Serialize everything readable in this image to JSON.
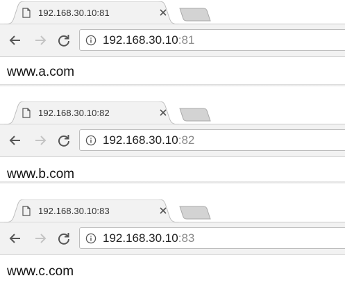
{
  "windows": [
    {
      "tab_title": "192.168.30.10:81",
      "url_host": "192.168.30.10",
      "url_port": ":81",
      "page_text": "www.a.com"
    },
    {
      "tab_title": "192.168.30.10:82",
      "url_host": "192.168.30.10",
      "url_port": ":82",
      "page_text": "www.b.com"
    },
    {
      "tab_title": "192.168.30.10:83",
      "url_host": "192.168.30.10",
      "url_port": ":83",
      "page_text": "www.c.com"
    }
  ],
  "icons": {
    "favicon": "page-icon",
    "close": "close-icon",
    "back": "back-arrow-icon",
    "forward": "forward-arrow-icon",
    "reload": "reload-icon",
    "site_info": "info-icon"
  },
  "colors": {
    "toolbar": "#f2f2f2",
    "new_tab_button": "#d3d3d3",
    "url_port": "#8a8a8a"
  }
}
